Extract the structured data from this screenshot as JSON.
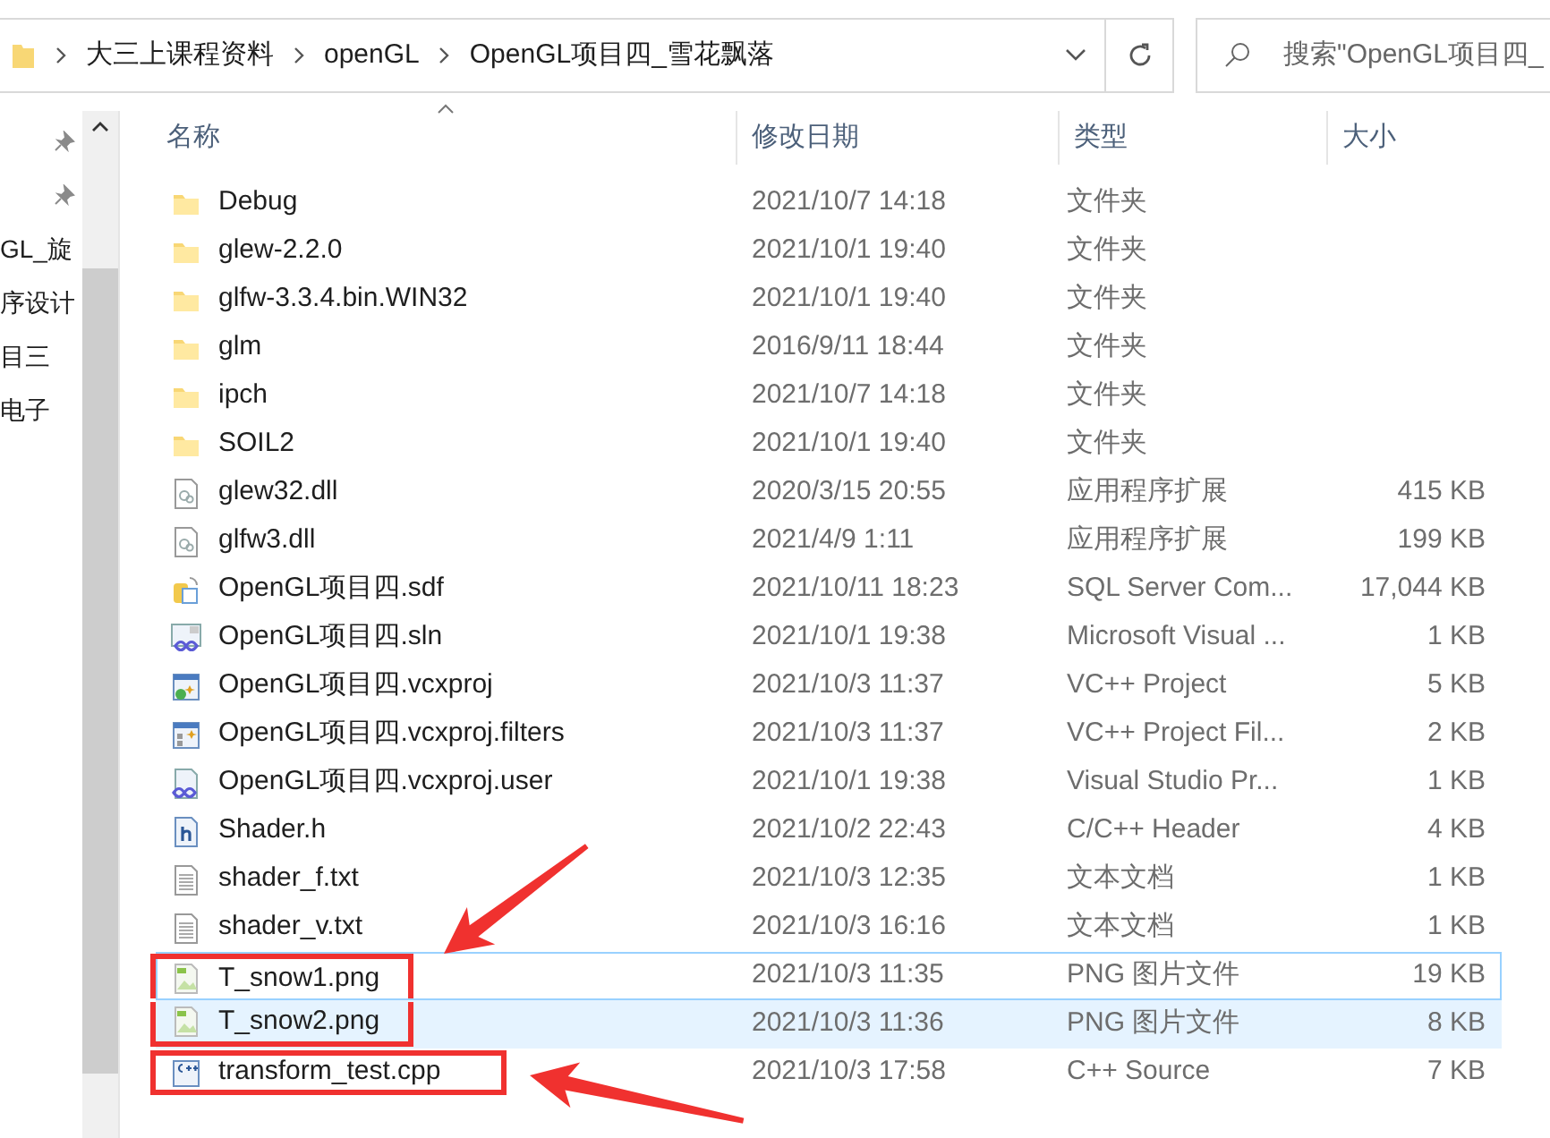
{
  "address_bar": {
    "crumbs": [
      "大三上课程资料",
      "openGL",
      "OpenGL项目四_雪花飘落"
    ]
  },
  "search": {
    "placeholder": "搜索\"OpenGL项目四_"
  },
  "nav_pane": {
    "items": [
      {
        "kind": "pin"
      },
      {
        "kind": "pin"
      },
      {
        "kind": "text",
        "label": "GL_旋"
      },
      {
        "kind": "text",
        "label": "序设计"
      },
      {
        "kind": "text",
        "label": "目三"
      },
      {
        "kind": "text",
        "label": "电子"
      }
    ]
  },
  "columns": [
    {
      "label": "名称",
      "sorted": true
    },
    {
      "label": "修改日期",
      "sorted": false
    },
    {
      "label": "类型",
      "sorted": false
    },
    {
      "label": "大小",
      "sorted": false
    }
  ],
  "files": [
    {
      "kind": "folder",
      "name": "Debug",
      "date": "2021/10/7 14:18",
      "type": "文件夹",
      "selected": false,
      "focused": false,
      "boxed": false
    },
    {
      "kind": "folder",
      "name": "glew-2.2.0",
      "date": "2021/10/1 19:40",
      "type": "文件夹",
      "selected": false,
      "focused": false,
      "boxed": false
    },
    {
      "kind": "folder",
      "name": "glfw-3.3.4.bin.WIN32",
      "date": "2021/10/1 19:40",
      "type": "文件夹",
      "selected": false,
      "focused": false,
      "boxed": false
    },
    {
      "kind": "folder",
      "name": "glm",
      "date": "2016/9/11 18:44",
      "type": "文件夹",
      "selected": false,
      "focused": false,
      "boxed": false
    },
    {
      "kind": "folder",
      "name": "ipch",
      "date": "2021/10/7 14:18",
      "type": "文件夹",
      "selected": false,
      "focused": false,
      "boxed": false
    },
    {
      "kind": "folder",
      "name": "SOIL2",
      "date": "2021/10/1 19:40",
      "type": "文件夹",
      "selected": false,
      "focused": false,
      "boxed": false
    },
    {
      "kind": "dll",
      "name": "glew32.dll",
      "date": "2020/3/15 20:55",
      "type": "应用程序扩展",
      "size": "415 KB",
      "selected": false,
      "focused": false,
      "boxed": false
    },
    {
      "kind": "dll",
      "name": "glfw3.dll",
      "date": "2021/4/9 1:11",
      "type": "应用程序扩展",
      "size": "199 KB",
      "selected": false,
      "focused": false,
      "boxed": false
    },
    {
      "kind": "database",
      "name": "OpenGL项目四.sdf",
      "date": "2021/10/11 18:23",
      "type": "SQL Server Com...",
      "size": "17,044 KB",
      "selected": false,
      "focused": false,
      "boxed": false
    },
    {
      "kind": "solution",
      "name": "OpenGL项目四.sln",
      "date": "2021/10/1 19:38",
      "type": "Microsoft Visual ...",
      "size": "1 KB",
      "selected": false,
      "focused": false,
      "boxed": false
    },
    {
      "kind": "project",
      "name": "OpenGL项目四.vcxproj",
      "date": "2021/10/3 11:37",
      "type": "VC++ Project",
      "size": "5 KB",
      "selected": false,
      "focused": false,
      "boxed": false
    },
    {
      "kind": "filters",
      "name": "OpenGL项目四.vcxproj.filters",
      "date": "2021/10/3 11:37",
      "type": "VC++ Project Fil...",
      "size": "2 KB",
      "selected": false,
      "focused": false,
      "boxed": false
    },
    {
      "kind": "user",
      "name": "OpenGL项目四.vcxproj.user",
      "date": "2021/10/1 19:38",
      "type": "Visual Studio Pr...",
      "size": "1 KB",
      "selected": false,
      "focused": false,
      "boxed": false
    },
    {
      "kind": "header",
      "name": "Shader.h",
      "date": "2021/10/2 22:43",
      "type": "C/C++ Header",
      "size": "4 KB",
      "selected": false,
      "focused": false,
      "boxed": false
    },
    {
      "kind": "text",
      "name": "shader_f.txt",
      "date": "2021/10/3 12:35",
      "type": "文本文档",
      "size": "1 KB",
      "selected": false,
      "focused": false,
      "boxed": false
    },
    {
      "kind": "text",
      "name": "shader_v.txt",
      "date": "2021/10/3 16:16",
      "type": "文本文档",
      "size": "1 KB",
      "selected": false,
      "focused": false,
      "boxed": false
    },
    {
      "kind": "image",
      "name": "T_snow1.png",
      "date": "2021/10/3 11:35",
      "type": "PNG 图片文件",
      "size": "19 KB",
      "selected": false,
      "focused": true,
      "boxed": true,
      "arrow_from_above": true
    },
    {
      "kind": "image",
      "name": "T_snow2.png",
      "date": "2021/10/3 11:36",
      "type": "PNG 图片文件",
      "size": "8 KB",
      "selected": true,
      "focused": false,
      "boxed": true
    },
    {
      "kind": "cpp",
      "name": "transform_test.cpp",
      "date": "2021/10/3 17:58",
      "type": "C++ Source",
      "size": "7 KB",
      "selected": false,
      "focused": false,
      "boxed": true,
      "arrow_from_right": true
    }
  ]
}
